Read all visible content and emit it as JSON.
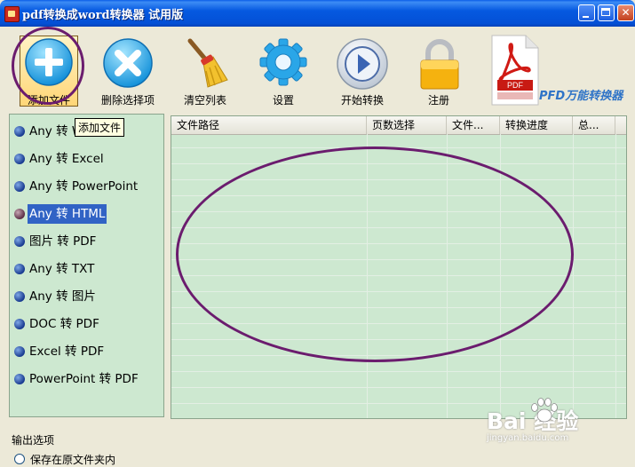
{
  "window": {
    "title": "pdf转换成word转换器 试用版",
    "controls": [
      "minimize",
      "maximize",
      "close"
    ]
  },
  "toolbar": {
    "add_label": "添加文件",
    "remove_label": "删除选择项",
    "clear_label": "清空列表",
    "settings_label": "设置",
    "start_label": "开始转换",
    "register_label": "注册",
    "brand": "PFD万能转换器",
    "logo_text": "PDF"
  },
  "tooltip": "添加文件",
  "conversions": {
    "items": [
      {
        "label": "Any 转 Word",
        "selected": false
      },
      {
        "label": "Any 转 Excel",
        "selected": false
      },
      {
        "label": "Any 转 PowerPoint",
        "selected": false
      },
      {
        "label": "Any 转 HTML",
        "selected": true
      },
      {
        "label": "图片 转 PDF",
        "selected": false
      },
      {
        "label": "Any 转 TXT",
        "selected": false
      },
      {
        "label": "Any 转 图片",
        "selected": false
      },
      {
        "label": "DOC 转 PDF",
        "selected": false
      },
      {
        "label": "Excel 转 PDF",
        "selected": false
      },
      {
        "label": "PowerPoint 转 PDF",
        "selected": false
      }
    ]
  },
  "table": {
    "columns": [
      "文件路径",
      "页数选择",
      "文件...",
      "转换进度",
      "总..."
    ],
    "rows": []
  },
  "output": {
    "section_label": "输出选项",
    "option_label": "保存在原文件夹内"
  },
  "watermark": {
    "brand": "Bai 经验",
    "url": "jingyan.baidu.com"
  },
  "colors": {
    "titlebar": "#0559e0",
    "panel_bg": "#cde8d0",
    "selection": "#3163c5",
    "annotation": "#6b1c6e"
  },
  "icons": [
    "plus-icon",
    "delete-icon",
    "broom-icon",
    "gear-icon",
    "play-icon",
    "lock-icon",
    "pdf-logo-icon"
  ]
}
